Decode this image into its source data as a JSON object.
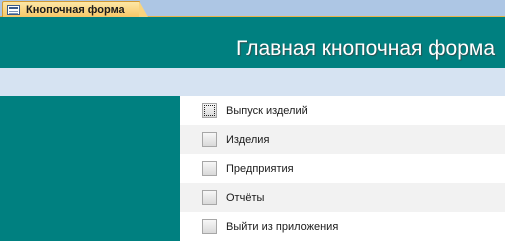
{
  "tab": {
    "label": "Кнопочная форма",
    "icon": "form-icon"
  },
  "header": {
    "title": "Главная кнопочная форма"
  },
  "menu": {
    "items": [
      {
        "label": "Выпуск изделий"
      },
      {
        "label": "Изделия"
      },
      {
        "label": "Предприятия"
      },
      {
        "label": "Отчёты"
      },
      {
        "label": "Выйти из приложения"
      }
    ]
  },
  "colors": {
    "header_bg": "#008080",
    "title_text": "#ffffff",
    "band_light": "#d6e3f2",
    "tab_active": "#f7c768"
  }
}
